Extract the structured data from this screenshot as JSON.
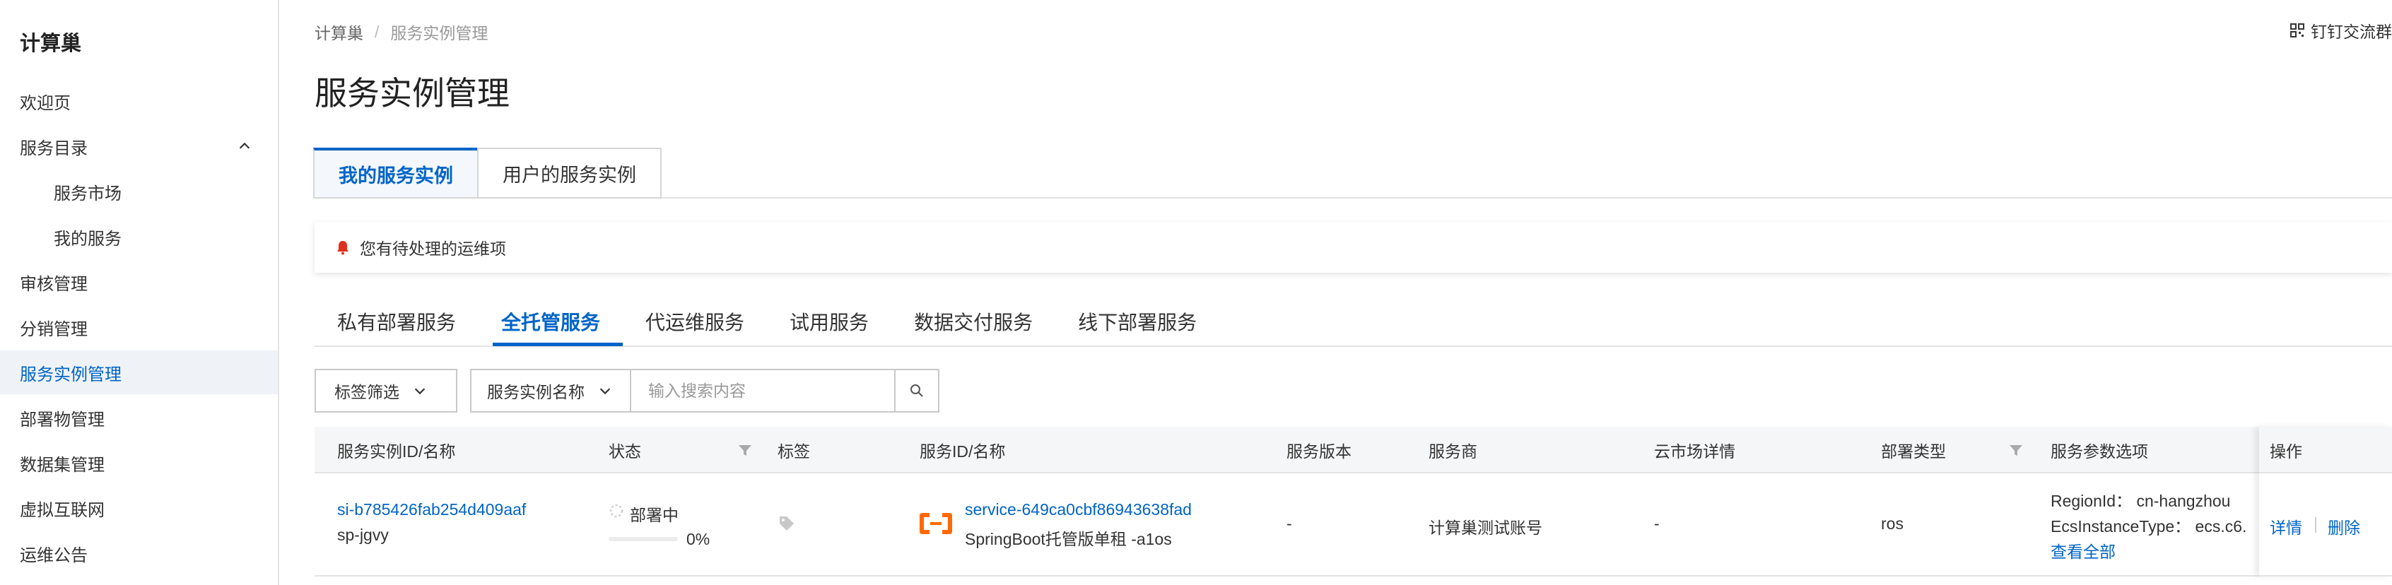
{
  "sidebar": {
    "title": "计算巢",
    "items": [
      {
        "label": "欢迎页"
      },
      {
        "label": "服务目录"
      },
      {
        "label": "服务市场"
      },
      {
        "label": "我的服务"
      },
      {
        "label": "审核管理"
      },
      {
        "label": "分销管理"
      },
      {
        "label": "服务实例管理"
      },
      {
        "label": "部署物管理"
      },
      {
        "label": "数据集管理"
      },
      {
        "label": "虚拟互联网"
      },
      {
        "label": "运维公告"
      }
    ]
  },
  "header": {
    "breadcrumb": [
      "计算巢",
      "服务实例管理"
    ],
    "top_right": "钉钉交流群",
    "title": "服务实例管理"
  },
  "main_tabs": [
    {
      "label": "我的服务实例"
    },
    {
      "label": "用户的服务实例"
    }
  ],
  "alert": {
    "text": "您有待处理的运维项"
  },
  "sub_tabs": [
    {
      "label": "私有部署服务"
    },
    {
      "label": "全托管服务"
    },
    {
      "label": "代运维服务"
    },
    {
      "label": "试用服务"
    },
    {
      "label": "数据交付服务"
    },
    {
      "label": "线下部署服务"
    }
  ],
  "filters": {
    "tag_filter": "标签筛选",
    "search_field": "服务实例名称",
    "search_placeholder": "输入搜索内容"
  },
  "table": {
    "columns": [
      "服务实例ID/名称",
      "状态",
      "标签",
      "服务ID/名称",
      "服务版本",
      "服务商",
      "云市场详情",
      "部署类型",
      "服务参数选项",
      "操作"
    ],
    "rows": [
      {
        "instance_id": "si-b785426fab254d409aaf",
        "instance_name": "sp-jgvy",
        "status": "部署中",
        "progress": "0%",
        "progress_value": 0,
        "service_id": "service-649ca0cbf86943638fad",
        "service_name": "SpringBoot托管版单租 -a1os",
        "version": "-",
        "provider": "计算巢测试账号",
        "market": "-",
        "deploy_type": "ros",
        "param1": "RegionId： cn-hangzhou",
        "param2": "EcsInstanceType： ecs.c6.",
        "view_all": "查看全部",
        "op_detail": "详情",
        "op_delete": "删除"
      }
    ]
  },
  "colors": {
    "accent": "#0064c8",
    "alert_icon": "#e0301e",
    "service_icon": "#ff6a00"
  }
}
